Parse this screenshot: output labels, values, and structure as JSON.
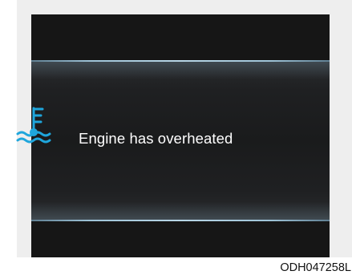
{
  "display": {
    "message": "Engine has overheated",
    "icon": "engine-coolant-temperature-icon",
    "icon_color": "#1fa6dc"
  },
  "figure_code": "ODH047258L"
}
